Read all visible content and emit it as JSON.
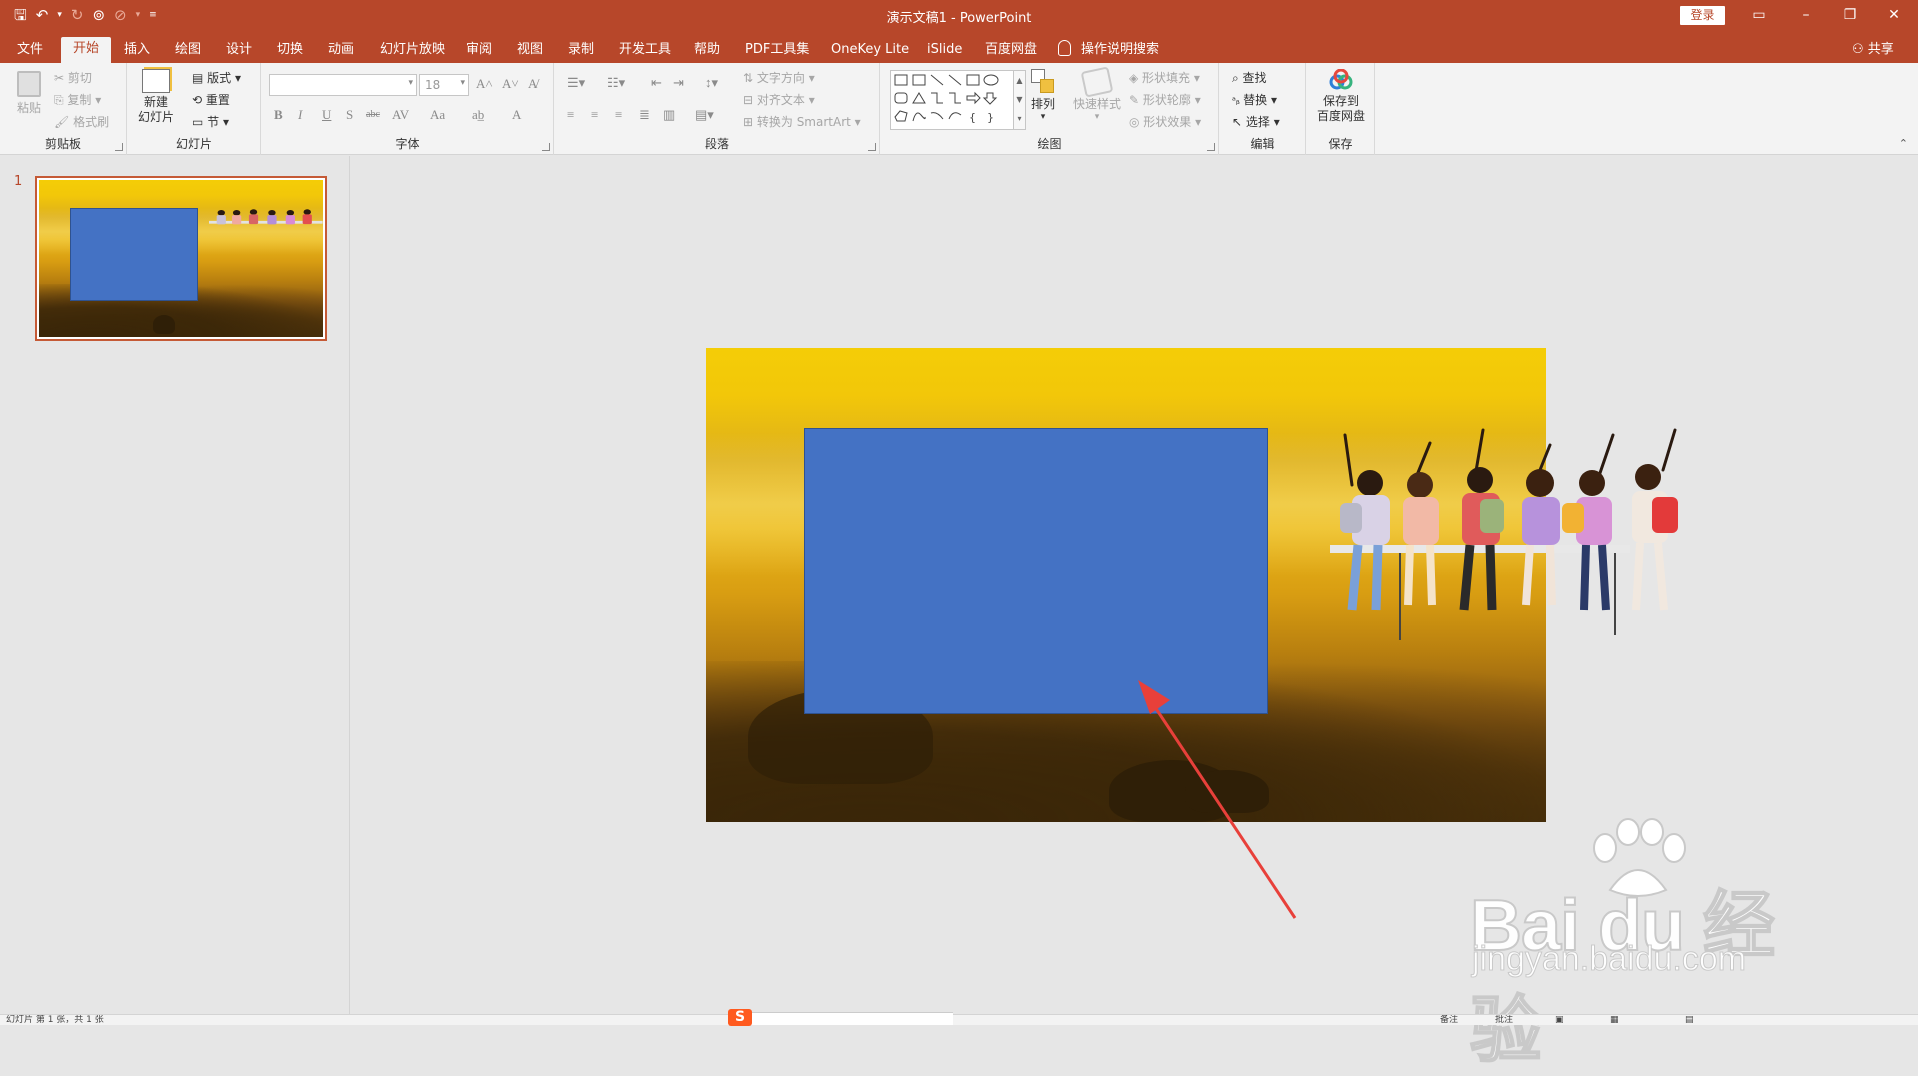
{
  "titlebar": {
    "title": "演示文稿1  -  PowerPoint",
    "login": "登录",
    "qat_icons": [
      "save-icon",
      "undo-icon",
      "redo-icon",
      "presenter-icon",
      "touch-mode-icon",
      "customize-icon"
    ]
  },
  "tabs": [
    "文件",
    "开始",
    "插入",
    "绘图",
    "设计",
    "切换",
    "动画",
    "幻灯片放映",
    "审阅",
    "视图",
    "录制",
    "开发工具",
    "帮助",
    "PDF工具集",
    "OneKey Lite",
    "iSlide",
    "百度网盘"
  ],
  "active_tab": "开始",
  "tell_me": "操作说明搜索",
  "share": "共享",
  "ribbon": {
    "clipboard": {
      "label": "剪贴板",
      "paste": "粘贴",
      "cut": "剪切",
      "copy": "复制",
      "format_painter": "格式刷"
    },
    "slides": {
      "label": "幻灯片",
      "new_slide": "新建\n幻灯片",
      "layout": "版式",
      "reset": "重置",
      "section": "节"
    },
    "font": {
      "label": "字体",
      "font_name": "",
      "font_size": "18",
      "buttons": [
        "B",
        "I",
        "U",
        "S",
        "abc",
        "AV",
        "Aa",
        "A"
      ]
    },
    "paragraph": {
      "label": "段落",
      "text_direction": "文字方向",
      "align_text": "对齐文本",
      "convert_smartart": "转换为 SmartArt"
    },
    "drawing": {
      "label": "绘图",
      "arrange": "排列",
      "quick_styles": "快速样式",
      "shape_fill": "形状填充",
      "shape_outline": "形状轮廓",
      "shape_effects": "形状效果"
    },
    "editing": {
      "label": "编辑",
      "find": "查找",
      "replace": "替换",
      "select": "选择"
    },
    "save": {
      "label": "保存",
      "save_to": "保存到\n百度网盘"
    }
  },
  "thumbnails": [
    {
      "number": "1"
    }
  ],
  "status": {
    "left": "幻灯片 第 1 张，共 1 张",
    "notes": "备注",
    "comments": "批注"
  },
  "watermark": {
    "brand": "Bai du 经验",
    "url": "jingyan.baidu.com"
  },
  "colors": {
    "accent": "#b7472a",
    "shape_fill": "#4472c4",
    "arrow": "#e8403a"
  }
}
